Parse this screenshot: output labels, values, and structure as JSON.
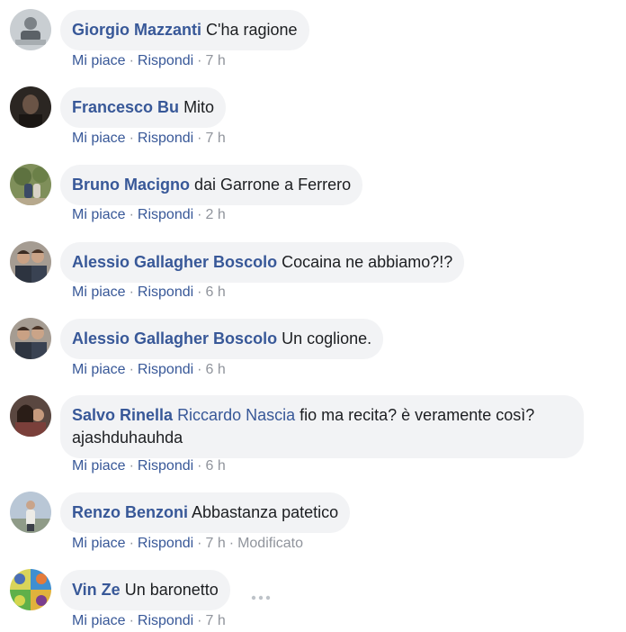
{
  "comments": [
    {
      "author": "Giorgio Mazzanti",
      "mention": "",
      "text": "C'ha ragione",
      "like": "Mi piace",
      "reply": "Rispondi",
      "time": "7 h",
      "extra": ""
    },
    {
      "author": "Francesco Bu",
      "mention": "",
      "text": "Mito",
      "like": "Mi piace",
      "reply": "Rispondi",
      "time": "7 h",
      "extra": ""
    },
    {
      "author": "Bruno Macigno",
      "mention": "",
      "text": "dai Garrone a Ferrero",
      "like": "Mi piace",
      "reply": "Rispondi",
      "time": "2 h",
      "extra": ""
    },
    {
      "author": "Alessio Gallagher Boscolo",
      "mention": "",
      "text": "Cocaina ne abbiamo?!?",
      "like": "Mi piace",
      "reply": "Rispondi",
      "time": "6 h",
      "extra": ""
    },
    {
      "author": "Alessio Gallagher Boscolo",
      "mention": "",
      "text": "Un coglione.",
      "like": "Mi piace",
      "reply": "Rispondi",
      "time": "6 h",
      "extra": ""
    },
    {
      "author": "Salvo Rinella",
      "mention": "Riccardo Nascia",
      "text": "fio ma recita? è veramente così? ajashduhauhda",
      "like": "Mi piace",
      "reply": "Rispondi",
      "time": "6 h",
      "extra": ""
    },
    {
      "author": "Renzo Benzoni",
      "mention": "",
      "text": "Abbastanza patetico",
      "like": "Mi piace",
      "reply": "Rispondi",
      "time": "7 h",
      "extra": "Modificato"
    },
    {
      "author": "Vin Ze",
      "mention": "",
      "text": "Un baronetto",
      "like": "Mi piace",
      "reply": "Rispondi",
      "time": "7 h",
      "extra": ""
    }
  ],
  "icons": {
    "more": "more-options-icon"
  },
  "colors": {
    "link": "#385898",
    "meta": "#90949c",
    "bubble": "#f2f3f5",
    "text": "#1c1e21"
  }
}
